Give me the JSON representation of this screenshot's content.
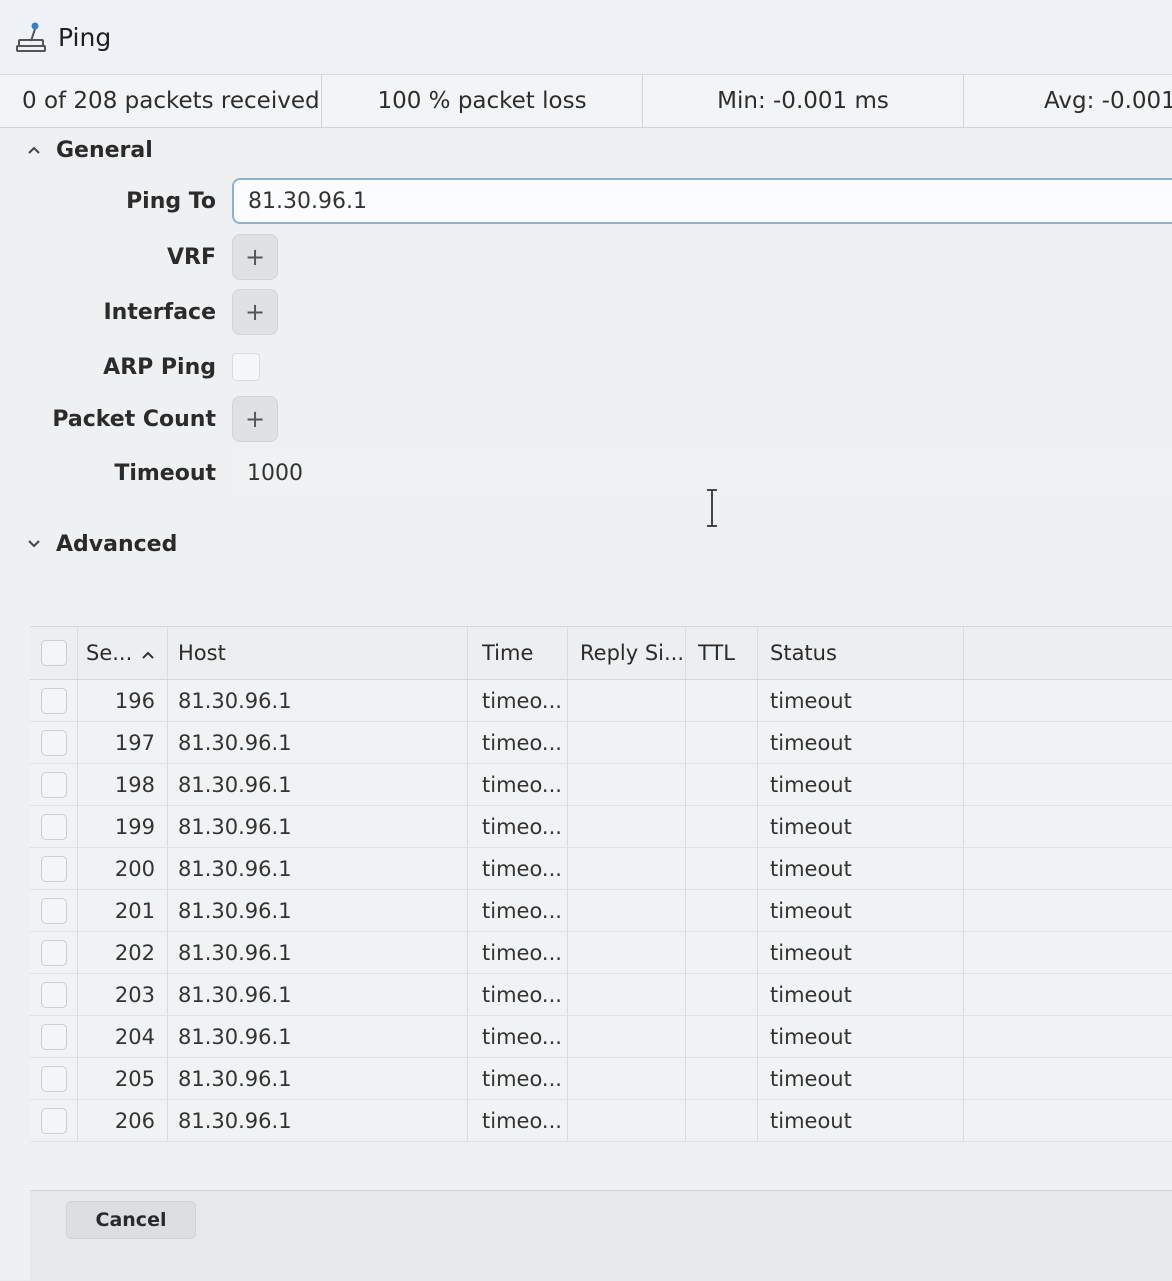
{
  "window": {
    "title": "Ping"
  },
  "stats": {
    "received": "0 of 208 packets received",
    "loss": "100 % packet loss",
    "min": "Min: -0.001 ms",
    "avg": "Avg: -0.001"
  },
  "general": {
    "header": "General",
    "ping_to_label": "Ping To",
    "ping_to_value": "81.30.96.1",
    "vrf_label": "VRF",
    "interface_label": "Interface",
    "arp_ping_label": "ARP Ping",
    "packet_count_label": "Packet Count",
    "timeout_label": "Timeout",
    "timeout_value": "1000",
    "plus_glyph": "+"
  },
  "advanced": {
    "header": "Advanced"
  },
  "table": {
    "columns": {
      "seq": "Se...",
      "host": "Host",
      "time": "Time",
      "reply_size": "Reply Si...",
      "ttl": "TTL",
      "status": "Status"
    },
    "rows": [
      {
        "seq": "196",
        "host": "81.30.96.1",
        "time": "timeo...",
        "reply_size": "",
        "ttl": "",
        "status": "timeout"
      },
      {
        "seq": "197",
        "host": "81.30.96.1",
        "time": "timeo...",
        "reply_size": "",
        "ttl": "",
        "status": "timeout"
      },
      {
        "seq": "198",
        "host": "81.30.96.1",
        "time": "timeo...",
        "reply_size": "",
        "ttl": "",
        "status": "timeout"
      },
      {
        "seq": "199",
        "host": "81.30.96.1",
        "time": "timeo...",
        "reply_size": "",
        "ttl": "",
        "status": "timeout"
      },
      {
        "seq": "200",
        "host": "81.30.96.1",
        "time": "timeo...",
        "reply_size": "",
        "ttl": "",
        "status": "timeout"
      },
      {
        "seq": "201",
        "host": "81.30.96.1",
        "time": "timeo...",
        "reply_size": "",
        "ttl": "",
        "status": "timeout"
      },
      {
        "seq": "202",
        "host": "81.30.96.1",
        "time": "timeo...",
        "reply_size": "",
        "ttl": "",
        "status": "timeout"
      },
      {
        "seq": "203",
        "host": "81.30.96.1",
        "time": "timeo...",
        "reply_size": "",
        "ttl": "",
        "status": "timeout"
      },
      {
        "seq": "204",
        "host": "81.30.96.1",
        "time": "timeo...",
        "reply_size": "",
        "ttl": "",
        "status": "timeout"
      },
      {
        "seq": "205",
        "host": "81.30.96.1",
        "time": "timeo...",
        "reply_size": "",
        "ttl": "",
        "status": "timeout"
      },
      {
        "seq": "206",
        "host": "81.30.96.1",
        "time": "timeo...",
        "reply_size": "",
        "ttl": "",
        "status": "timeout"
      }
    ]
  },
  "footer": {
    "cancel_label": "Cancel"
  },
  "icons": {
    "app": "ping-app-icon",
    "general_toggle": "chevron-up-icon",
    "advanced_toggle": "chevron-down-icon",
    "sort": "sort-ascending-icon",
    "cursor": "text-cursor-icon"
  }
}
